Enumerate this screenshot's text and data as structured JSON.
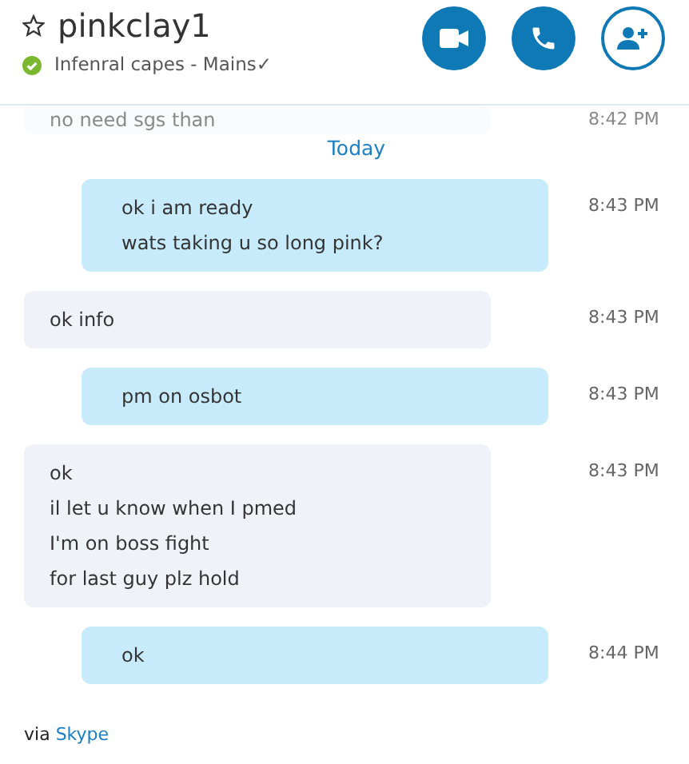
{
  "contact": {
    "name": "pinkclay1",
    "favorite": false,
    "online": true,
    "status": "Infenral capes - Mains✓"
  },
  "buttons": [
    {
      "kind": "video"
    },
    {
      "kind": "call"
    },
    {
      "kind": "add-contact"
    }
  ],
  "messages": [
    {
      "outgoing": false,
      "faded": true,
      "lines": [
        "no need sgs than"
      ],
      "time": "8:42 PM"
    },
    {
      "kind": "divider",
      "label": "Today"
    },
    {
      "outgoing": true,
      "faded": false,
      "lines": [
        "ok i am ready",
        "wats taking u so long pink?"
      ],
      "time": "8:43 PM"
    },
    {
      "outgoing": false,
      "faded": false,
      "lines": [
        "ok info"
      ],
      "time": "8:43 PM"
    },
    {
      "outgoing": true,
      "faded": false,
      "lines": [
        "pm on osbot"
      ],
      "time": "8:43 PM"
    },
    {
      "outgoing": false,
      "faded": false,
      "lines": [
        "ok",
        "il let u know when I pmed",
        "I'm on boss fight",
        "for last guy plz hold"
      ],
      "time": "8:43 PM"
    },
    {
      "outgoing": true,
      "faded": false,
      "lines": [
        "ok"
      ],
      "time": "8:44 PM"
    }
  ],
  "footer": {
    "prefix": "via",
    "link": "Skype"
  }
}
